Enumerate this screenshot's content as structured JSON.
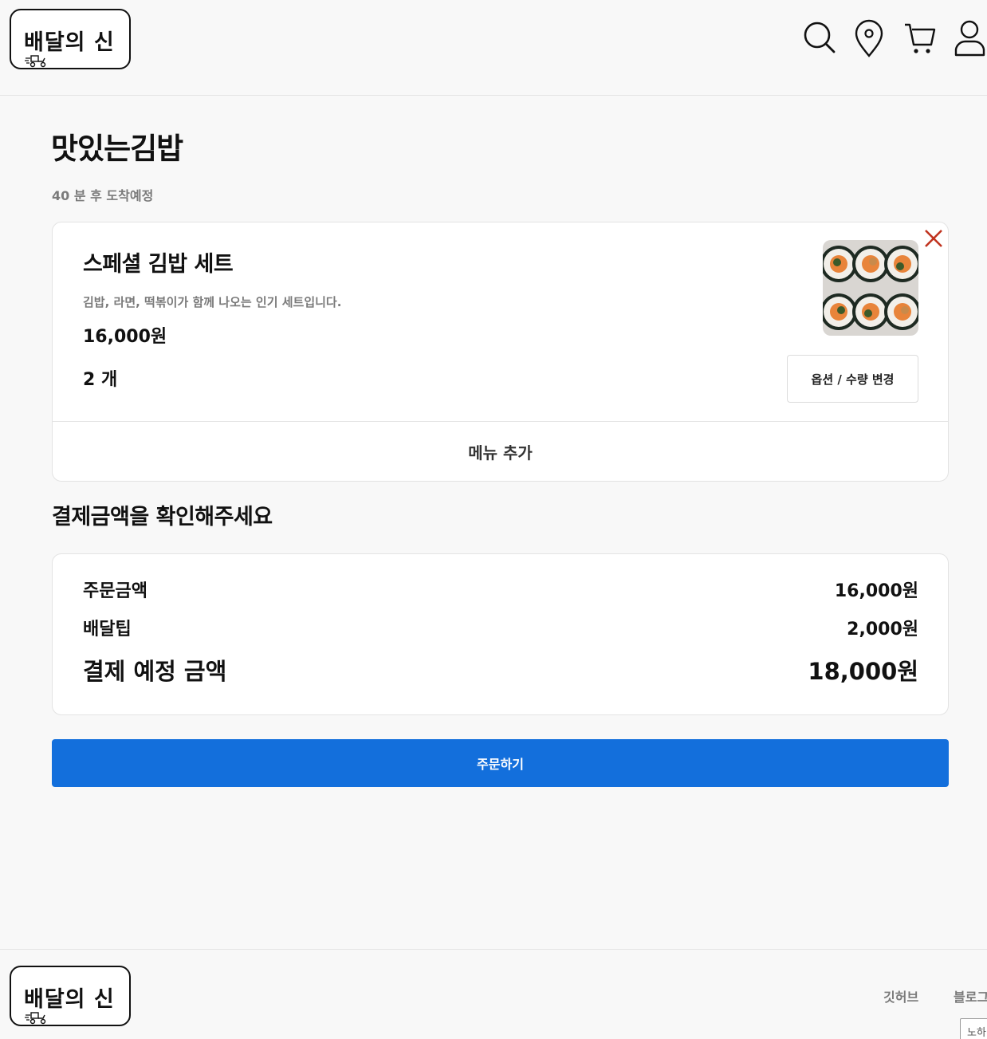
{
  "header": {
    "logo_text": "배달의 신",
    "icons": [
      "search-icon",
      "location-pin-icon",
      "cart-icon",
      "user-icon"
    ]
  },
  "store": {
    "name": "맛있는김밥",
    "eta": "40 분 후 도착예정"
  },
  "cart": {
    "item": {
      "name": "스페셜 김밥 세트",
      "description": "김밥, 라면, 떡볶이가 함께 나오는 인기 세트입니다.",
      "price": "16,000원",
      "quantity": "2 개"
    },
    "option_button": "옵션 / 수량 변경",
    "add_menu": "메뉴 추가"
  },
  "payment": {
    "title": "결제금액을 확인해주세요",
    "order_amount_label": "주문금액",
    "order_amount": "16,000원",
    "delivery_tip_label": "배달팁",
    "delivery_tip": "2,000원",
    "total_label": "결제 예정 금액",
    "total": "18,000원"
  },
  "order_button": "주문하기",
  "footer": {
    "logo_text": "배달의 신",
    "links": [
      "깃허브",
      "블로그"
    ],
    "select_value": "노하"
  },
  "colors": {
    "primary": "#136fdc",
    "remove": "#c0321e",
    "muted_text": "#7a7a7a"
  }
}
